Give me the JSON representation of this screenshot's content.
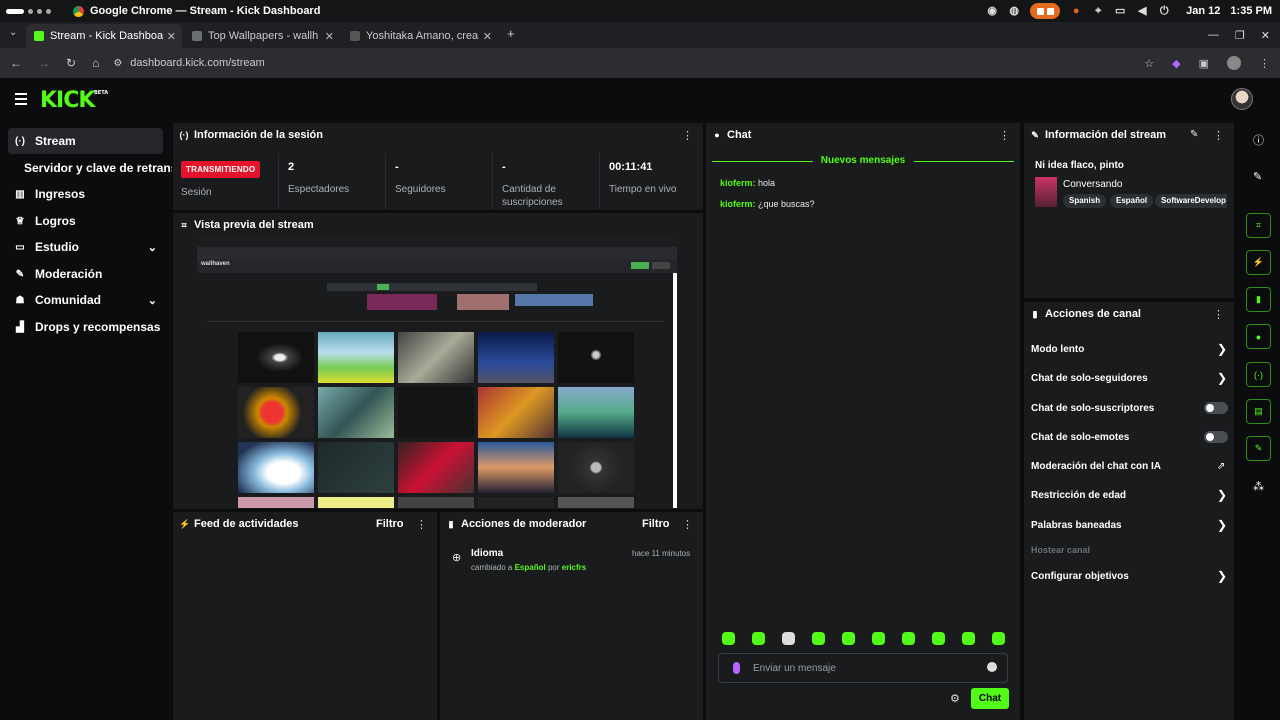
{
  "os": {
    "window_title": "Google Chrome — Stream - Kick Dashboard",
    "date": "Jan 12",
    "time": "1:35 PM"
  },
  "browser": {
    "tabs": [
      {
        "label": "Stream - Kick Dashboa",
        "active": true
      },
      {
        "label": "Top Wallpapers - wallh",
        "active": false
      },
      {
        "label": "Yoshitaka Amano, crea",
        "active": false
      }
    ],
    "url": "dashboard.kick.com/stream"
  },
  "header": {
    "logo": "KICK",
    "logo_badge": "BETA"
  },
  "sidebar": {
    "items": [
      {
        "label": "Stream",
        "icon": "broadcast-icon",
        "glyph": "(·)",
        "active": true
      },
      {
        "label": "Servidor y clave de retransmisión",
        "icon": "",
        "glyph": ""
      },
      {
        "label": "Ingresos",
        "icon": "bank-icon",
        "glyph": "▥"
      },
      {
        "label": "Logros",
        "icon": "trophy-icon",
        "glyph": "♕"
      },
      {
        "label": "Estudio",
        "icon": "studio-icon",
        "glyph": "▭",
        "chevron": "⌄"
      },
      {
        "label": "Moderación",
        "icon": "wrench-icon",
        "glyph": "✎"
      },
      {
        "label": "Comunidad",
        "icon": "community-icon",
        "glyph": "☗",
        "chevron": "⌄"
      },
      {
        "label": "Drops y recompensas",
        "icon": "drops-icon",
        "glyph": "▟"
      }
    ]
  },
  "session": {
    "title": "Información de la sesión",
    "live_badge": "TRANSMITIENDO",
    "live_label": "Sesión",
    "viewers_value": "2",
    "viewers_label": "Espectadores",
    "followers_value": "-",
    "followers_label": "Seguidores",
    "subs_value": "-",
    "subs_label": "Cantidad de suscripciones",
    "uptime_value": "00:11:41",
    "uptime_label": "Tiempo en vivo"
  },
  "preview": {
    "title": "Vista previa del stream",
    "inner_brand": "wallhaven"
  },
  "activity": {
    "title": "Feed de actividades",
    "filter": "Filtro"
  },
  "modactions": {
    "title": "Acciones de moderador",
    "filter": "Filtro",
    "entry_title": "Idioma",
    "entry_time": "hace 11 minutos",
    "entry_prefix": "cambiado a",
    "entry_value": "Español",
    "entry_by": "por",
    "entry_user": "ericfrs"
  },
  "chat": {
    "title": "Chat",
    "new_messages": "Nuevos mensajes",
    "messages": [
      {
        "user": "kioferm:",
        "text": " hola"
      },
      {
        "user": "kioferm:",
        "text": " ¿que buscas?"
      }
    ],
    "input_placeholder": "Enviar un mensaje",
    "send_label": "Chat"
  },
  "streaminfo": {
    "title": "Información del stream",
    "stream_title": "Ni idea flaco, pinto",
    "category": "Conversando",
    "tags": [
      "Spanish",
      "Español",
      "SoftwareDevelop"
    ]
  },
  "channelactions": {
    "title": "Acciones de canal",
    "rows": [
      {
        "label": "Modo lento",
        "control": "chevron"
      },
      {
        "label": "Chat de solo-seguidores",
        "control": "chevron"
      },
      {
        "label": "Chat de solo-suscriptores",
        "control": "toggle",
        "on": false
      },
      {
        "label": "Chat de solo-emotes",
        "control": "toggle",
        "on": false
      },
      {
        "label": "Moderación del chat con IA",
        "control": "external"
      },
      {
        "label": "Restricción de edad",
        "control": "chevron"
      },
      {
        "label": "Palabras baneadas",
        "control": "chevron"
      },
      {
        "label": "Hostear canal",
        "control": "disabled"
      },
      {
        "label": "Configurar objetivos",
        "control": "chevron"
      }
    ]
  },
  "colors": {
    "accent": "#53fc18",
    "live": "#e2132b",
    "panel": "#191b1c"
  }
}
